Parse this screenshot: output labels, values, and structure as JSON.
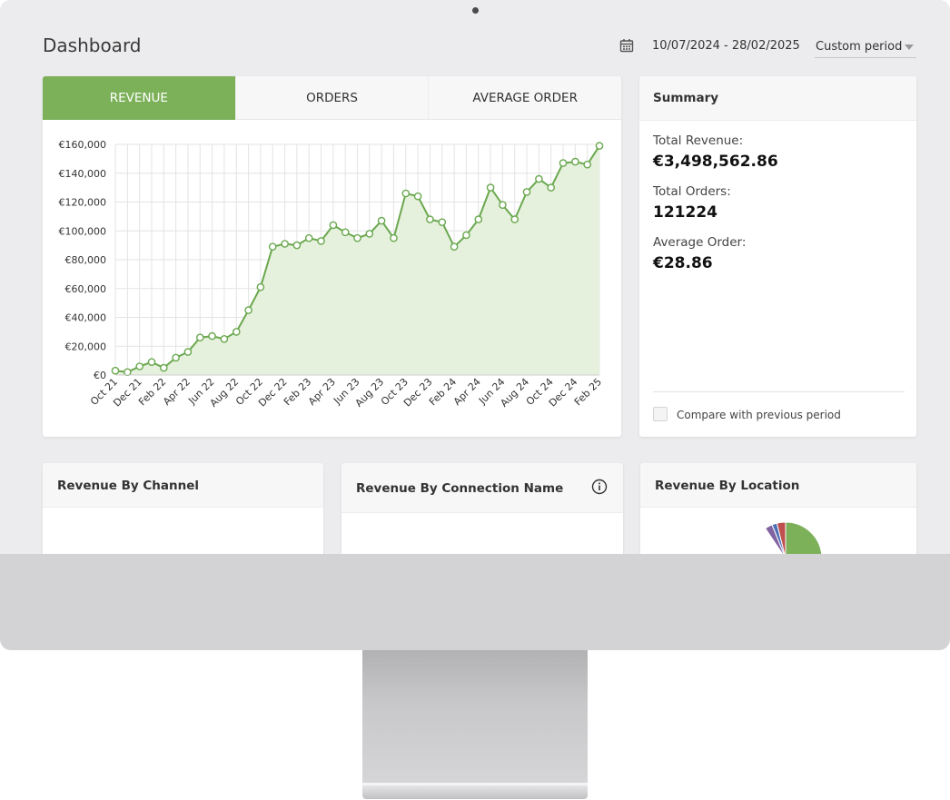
{
  "page": {
    "title": "Dashboard"
  },
  "header": {
    "calendar_icon": "calendar-icon",
    "date_range": "10/07/2024 - 28/02/2025",
    "period_select": "Custom period",
    "caret_icon": "chevron-down-icon"
  },
  "tabs": [
    {
      "label": "REVENUE",
      "active": true
    },
    {
      "label": "ORDERS",
      "active": false
    },
    {
      "label": "AVERAGE ORDER",
      "active": false
    }
  ],
  "colors": {
    "accent": "#7cb15a",
    "line": "#6aa84f",
    "area": "#e6f1dd",
    "pie": [
      "#7cb15a",
      "#c0504d",
      "#4f6fb5",
      "#8064a2"
    ]
  },
  "summary": {
    "title": "Summary",
    "total_revenue_label": "Total Revenue:",
    "total_revenue": "€3,498,562.86",
    "total_orders_label": "Total Orders:",
    "total_orders": "121224",
    "average_order_label": "Average Order:",
    "average_order": "€28.86",
    "compare_label": "Compare with previous period",
    "compare_checked": false
  },
  "bottom_cards": [
    {
      "title": "Revenue By Channel"
    },
    {
      "title": "Revenue By Connection Name",
      "icon": "info-icon"
    },
    {
      "title": "Revenue By Location"
    }
  ],
  "chart_data": {
    "type": "area",
    "title": "",
    "xlabel": "",
    "ylabel": "",
    "ylim": [
      0,
      160000
    ],
    "y_ticks": [
      "€0",
      "€20,000",
      "€40,000",
      "€60,000",
      "€80,000",
      "€100,000",
      "€120,000",
      "€140,000",
      "€160,000"
    ],
    "x_tick_labels": [
      "Oct 21",
      "Dec 21",
      "Feb 22",
      "Apr 22",
      "Jun 22",
      "Aug 22",
      "Oct 22",
      "Dec 22",
      "Feb 23",
      "Apr 23",
      "Jun 23",
      "Aug 23",
      "Oct 23",
      "Dec 23",
      "Feb 24",
      "Apr 24",
      "Jun 24",
      "Aug 24",
      "Oct 24",
      "Dec 24",
      "Feb 25"
    ],
    "grid": true,
    "series": [
      {
        "values": [
          3000,
          2000,
          6000,
          9000,
          5000,
          12000,
          16000,
          26000,
          27000,
          25000,
          30000,
          45000,
          61000,
          89000,
          91000,
          90000,
          95000,
          93000,
          104000,
          99000,
          95000,
          98000,
          107000,
          95000,
          126000,
          124000,
          108000,
          106000,
          89000,
          97000,
          108000,
          130000,
          118000,
          108000,
          127000,
          136000,
          130000,
          147000,
          148000,
          146000,
          159000
        ]
      }
    ]
  }
}
